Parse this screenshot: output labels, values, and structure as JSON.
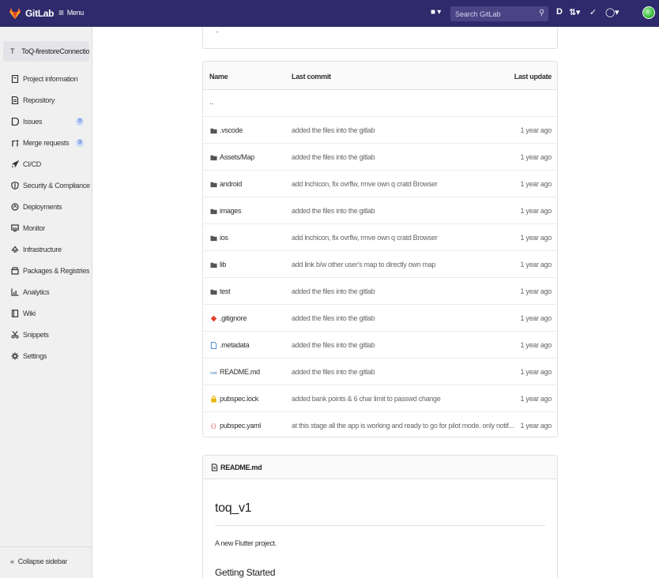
{
  "navbar": {
    "brand": "GitLab",
    "menu_label": "Menu",
    "plus_label": "■ ▾",
    "search_placeholder": "Search GitLab",
    "brand_color": "#2e2a6b"
  },
  "sidebar": {
    "project_initial": "T",
    "project_name": "ToQ-firestoreConnection",
    "items": [
      {
        "label": "Project information",
        "icon": "info-icon"
      },
      {
        "label": "Repository",
        "icon": "document-icon"
      },
      {
        "label": "Issues",
        "icon": "issues-icon",
        "badge": "0"
      },
      {
        "label": "Merge requests",
        "icon": "merge-request-icon",
        "badge": "0"
      },
      {
        "label": "CI/CD",
        "icon": "rocket-icon"
      },
      {
        "label": "Security & Compliance",
        "icon": "shield-icon"
      },
      {
        "label": "Deployments",
        "icon": "deployments-icon"
      },
      {
        "label": "Monitor",
        "icon": "monitor-icon"
      },
      {
        "label": "Infrastructure",
        "icon": "cloud-icon"
      },
      {
        "label": "Packages & Registries",
        "icon": "package-icon"
      },
      {
        "label": "Analytics",
        "icon": "chart-icon"
      },
      {
        "label": "Wiki",
        "icon": "book-icon"
      },
      {
        "label": "Snippets",
        "icon": "scissors-icon"
      },
      {
        "label": "Settings",
        "icon": "gear-icon"
      }
    ],
    "collapse_label": "Collapse sidebar"
  },
  "files": {
    "headers": {
      "name": "Name",
      "commit": "Last commit",
      "update": "Last update"
    },
    "updir": "..",
    "rows": [
      {
        "name": ".vscode",
        "icon": "folder-icon",
        "commit": "added the files into the gitlab",
        "date": "1 year ago"
      },
      {
        "name": "Assets/Map",
        "icon": "folder-icon",
        "commit": "added the files into the gitlab",
        "date": "1 year ago"
      },
      {
        "name": "android",
        "icon": "folder-icon",
        "commit": "add lnchicon, fix ovrflw, rmve own q cratd Browser",
        "date": "1 year ago"
      },
      {
        "name": "images",
        "icon": "folder-icon",
        "commit": "added the files into the gitlab",
        "date": "1 year ago"
      },
      {
        "name": "ios",
        "icon": "folder-icon",
        "commit": "add lnchicon, fix ovrflw, rmve own q cratd Browser",
        "date": "1 year ago"
      },
      {
        "name": "lib",
        "icon": "folder-icon",
        "commit": "add link b/w other user's map to directly own map",
        "date": "1 year ago"
      },
      {
        "name": "test",
        "icon": "folder-icon",
        "commit": "added the files into the gitlab",
        "date": "1 year ago"
      },
      {
        "name": ".gitignore",
        "icon": "git-icon",
        "commit": "added the files into the gitlab",
        "date": "1 year ago"
      },
      {
        "name": ".metadata",
        "icon": "file-icon",
        "commit": "added the files into the gitlab",
        "date": "1 year ago"
      },
      {
        "name": "README.md",
        "icon": "markdown-icon",
        "commit": "added the files into the gitlab",
        "date": "1 year ago"
      },
      {
        "name": "pubspec.lock",
        "icon": "lock-icon",
        "commit": "added bank points & 6 char limit to passwd change",
        "date": "1 year ago"
      },
      {
        "name": "pubspec.yaml",
        "icon": "yaml-icon",
        "commit": "at this stage all the app is working and ready to go for pilot mode. only notif...",
        "date": "1 year ago"
      }
    ]
  },
  "readme": {
    "label": "README.md",
    "title": "toq_v1",
    "description": "A new Flutter project.",
    "subtitle": "Getting Started"
  }
}
